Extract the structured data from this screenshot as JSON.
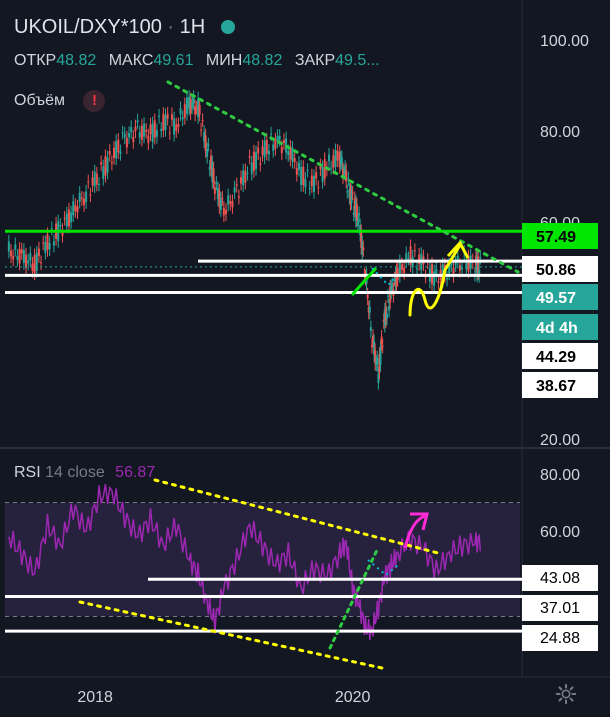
{
  "header": {
    "symbol": "UKOIL/DXY*100",
    "separator": "·",
    "interval": "1H",
    "ohlc": [
      {
        "label": "ОТКР",
        "value": "48.82"
      },
      {
        "label": "МАКС",
        "value": "49.61"
      },
      {
        "label": "МИН",
        "value": "48.82"
      },
      {
        "label": "ЗАКР",
        "value": "49.5..."
      }
    ],
    "volume_label": "Объём",
    "volume_warning": "!"
  },
  "rsi_header": {
    "name": "RSI",
    "params": "14 close",
    "value": "56.87"
  },
  "colors": {
    "background": "#131722",
    "up": "#26a69a",
    "down": "#ef5350",
    "rsi_line": "#9c27b0",
    "green_level": "#00e600",
    "yellow_drawing": "#ffff00",
    "magenta_arrow": "#ff2bd6"
  },
  "chart_data": [
    {
      "type": "candlestick",
      "title": "UKOIL/DXY*100",
      "x_tick_labels": [
        "2018",
        "2020"
      ],
      "x_range": [
        2017.3,
        2021.3
      ],
      "y_tick_labels": [
        "100.00",
        "80.00",
        "60.00",
        "20.00"
      ],
      "ylim": [
        14,
        102
      ],
      "series": [
        {
          "name": "UKOIL/DXY*100",
          "x": [
            2017.33,
            2017.43,
            2017.53,
            2017.63,
            2017.73,
            2017.83,
            2017.93,
            2018.03,
            2018.13,
            2018.23,
            2018.33,
            2018.43,
            2018.53,
            2018.63,
            2018.73,
            2018.8,
            2018.87,
            2018.93,
            2019.0,
            2019.1,
            2019.2,
            2019.3,
            2019.4,
            2019.5,
            2019.6,
            2019.7,
            2019.8,
            2019.9,
            2019.95,
            2020.0,
            2020.05,
            2020.1,
            2020.15,
            2020.2,
            2020.25,
            2020.3,
            2020.35,
            2020.45,
            2020.55,
            2020.65,
            2020.75,
            2020.85,
            2020.95,
            2021.0
          ],
          "values": [
            53,
            52,
            50,
            55,
            58,
            62,
            66,
            70,
            74,
            78,
            80,
            79,
            82,
            81,
            86,
            85,
            76,
            68,
            62,
            66,
            72,
            75,
            78,
            76,
            70,
            68,
            72,
            74,
            69,
            64,
            60,
            48,
            34,
            26,
            38,
            44,
            48,
            52,
            50,
            47,
            49,
            51,
            50,
            49.5
          ]
        }
      ],
      "price_labels": [
        "57.49",
        "50.86",
        "49.57",
        "4d 4h",
        "44.29",
        "38.67"
      ],
      "horizontal_levels": [
        57.49,
        50.86,
        47.7,
        43.9
      ]
    },
    {
      "type": "line",
      "title": "RSI 14 close",
      "y_tick_labels": [
        "80.00",
        "60.00",
        "43.08",
        "37.01",
        "24.88"
      ],
      "ylim": [
        16,
        84
      ],
      "overbought": 70,
      "oversold": 30,
      "series": [
        {
          "name": "RSI",
          "x": [
            2017.33,
            2017.43,
            2017.53,
            2017.63,
            2017.73,
            2017.83,
            2017.93,
            2018.03,
            2018.13,
            2018.23,
            2018.33,
            2018.43,
            2018.53,
            2018.63,
            2018.73,
            2018.8,
            2018.87,
            2018.93,
            2019.0,
            2019.1,
            2019.2,
            2019.3,
            2019.4,
            2019.5,
            2019.6,
            2019.7,
            2019.8,
            2019.9,
            2019.95,
            2020.0,
            2020.05,
            2020.1,
            2020.15,
            2020.2,
            2020.25,
            2020.3,
            2020.35,
            2020.45,
            2020.55,
            2020.65,
            2020.75,
            2020.85,
            2020.95,
            2021.0
          ],
          "values": [
            58,
            52,
            45,
            62,
            55,
            68,
            60,
            72,
            74,
            65,
            58,
            64,
            55,
            62,
            50,
            45,
            35,
            28,
            40,
            50,
            62,
            55,
            48,
            52,
            40,
            47,
            44,
            52,
            56,
            40,
            34,
            26,
            25,
            33,
            44,
            48,
            52,
            57,
            54,
            46,
            52,
            55,
            56,
            56.87
          ]
        }
      ],
      "horizontal_levels": [
        43.08,
        37.01,
        24.88
      ]
    }
  ]
}
